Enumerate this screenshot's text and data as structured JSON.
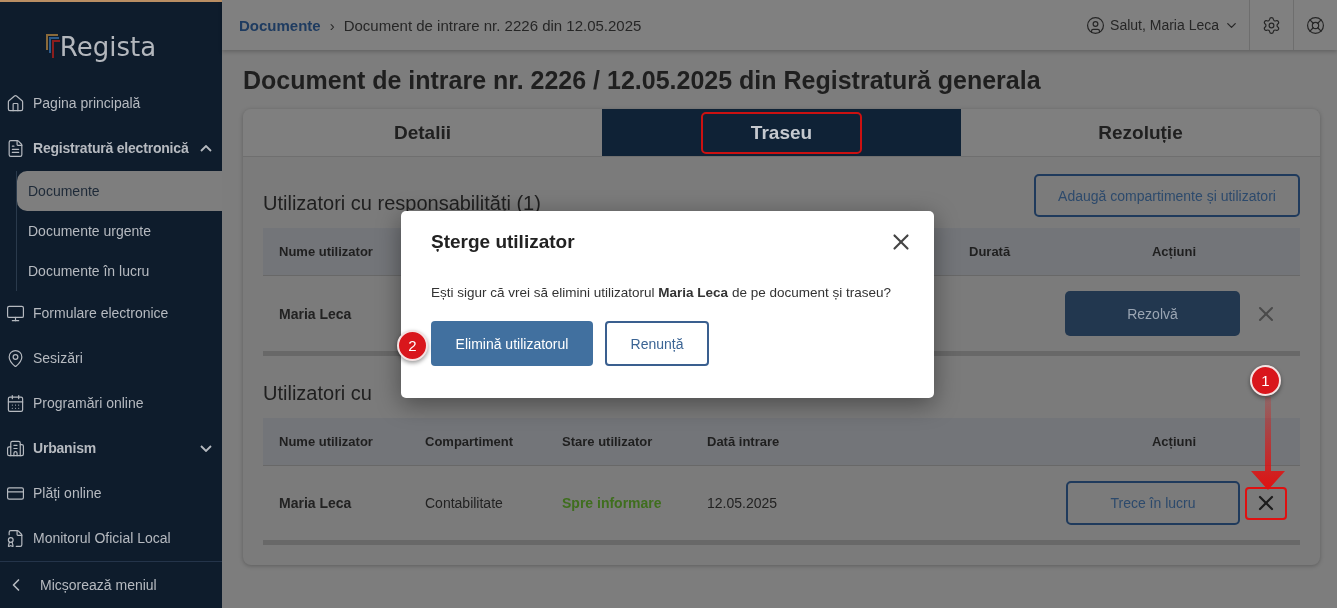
{
  "sidebar": {
    "logo": "Regista",
    "items": [
      {
        "label": "Pagina principală",
        "kind": "item",
        "selected": false
      },
      {
        "label": "Registratură electronică",
        "kind": "group",
        "expanded": true,
        "children": [
          {
            "label": "Documente",
            "selected": true
          },
          {
            "label": "Documente urgente",
            "selected": false
          },
          {
            "label": "Documente în lucru",
            "selected": false
          }
        ]
      },
      {
        "label": "Formulare electronice",
        "kind": "item",
        "selected": false
      },
      {
        "label": "Sesizări",
        "kind": "item",
        "selected": false
      },
      {
        "label": "Programări online",
        "kind": "item",
        "selected": false
      },
      {
        "label": "Urbanism",
        "kind": "group",
        "expanded": false
      },
      {
        "label": "Plăți online",
        "kind": "item",
        "selected": false
      },
      {
        "label": "Monitorul Oficial Local",
        "kind": "item",
        "selected": false
      }
    ],
    "collapse": "Micșorează meniul"
  },
  "breadcrumb": {
    "link": "Documente",
    "separator": "›",
    "current": "Document de intrare nr. 2226 din 12.05.2025"
  },
  "user": {
    "greeting": "Salut, Maria Leca"
  },
  "page_title": "Document de intrare nr. 2226 / 12.05.2025 din Registratură generala",
  "tabs": [
    {
      "label": "Detalii",
      "selected": false,
      "highlighted": false
    },
    {
      "label": "Traseu",
      "selected": true,
      "highlighted": true
    },
    {
      "label": "Rezoluție",
      "selected": false,
      "highlighted": false
    }
  ],
  "responsible": {
    "heading": "Utilizatori cu responsabilități (1)",
    "add_button": "Adaugă compartimente și utilizatori",
    "columns": [
      "Nume utilizator",
      "Durată",
      "Acțiuni"
    ],
    "rows": [
      {
        "name": "Maria Leca",
        "action": "Rezolvă",
        "remove_highlighted": false
      }
    ]
  },
  "informed": {
    "heading": "Utilizatori cu",
    "columns": [
      "Nume utilizator",
      "Compartiment",
      "Stare utilizator",
      "Dată intrare",
      "Acțiuni"
    ],
    "rows": [
      {
        "name": "Maria Leca",
        "department": "Contabilitate",
        "status": "Spre informare",
        "date": "12.05.2025",
        "action": "Trece în lucru",
        "remove_highlighted": true
      }
    ]
  },
  "dialog": {
    "title": "Șterge utilizator",
    "message": "Ești sigur că vrei să elimini utilizatorul **Maria Leca** de pe document și traseu?",
    "confirm": "Elimină utilizatorul",
    "cancel": "Renunță"
  },
  "annotations": [
    {
      "label": "1"
    },
    {
      "label": "2"
    }
  ]
}
